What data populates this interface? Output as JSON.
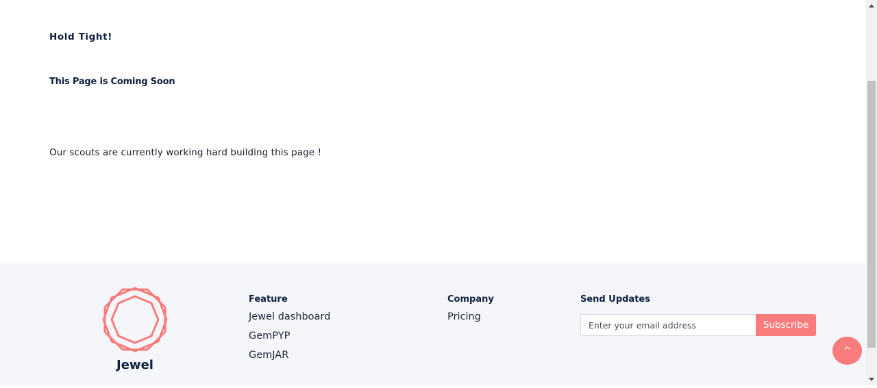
{
  "main": {
    "heading": "Hold Tight!",
    "subheading": "This Page is Coming Soon",
    "message": "Our scouts are currently working hard building this page !"
  },
  "footer": {
    "brand": {
      "name": "Jewel",
      "logo_icon": "octagon-gem-icon",
      "logo_color": "#f97c7c"
    },
    "feature": {
      "title": "Feature",
      "links": [
        "Jewel dashboard",
        "GemPYP",
        "GemJAR"
      ]
    },
    "company": {
      "title": "Company",
      "links": [
        "Pricing"
      ]
    },
    "updates": {
      "title": "Send Updates",
      "email_placeholder": "Enter your email address",
      "email_value": "",
      "subscribe_label": "Subscribe"
    }
  },
  "back_to_top": {
    "label": "^",
    "icon": "caret-up-icon"
  },
  "colors": {
    "accent": "#f97c7c",
    "heading_text": "#0f1f3d",
    "footer_bg": "#f5f6fa"
  }
}
